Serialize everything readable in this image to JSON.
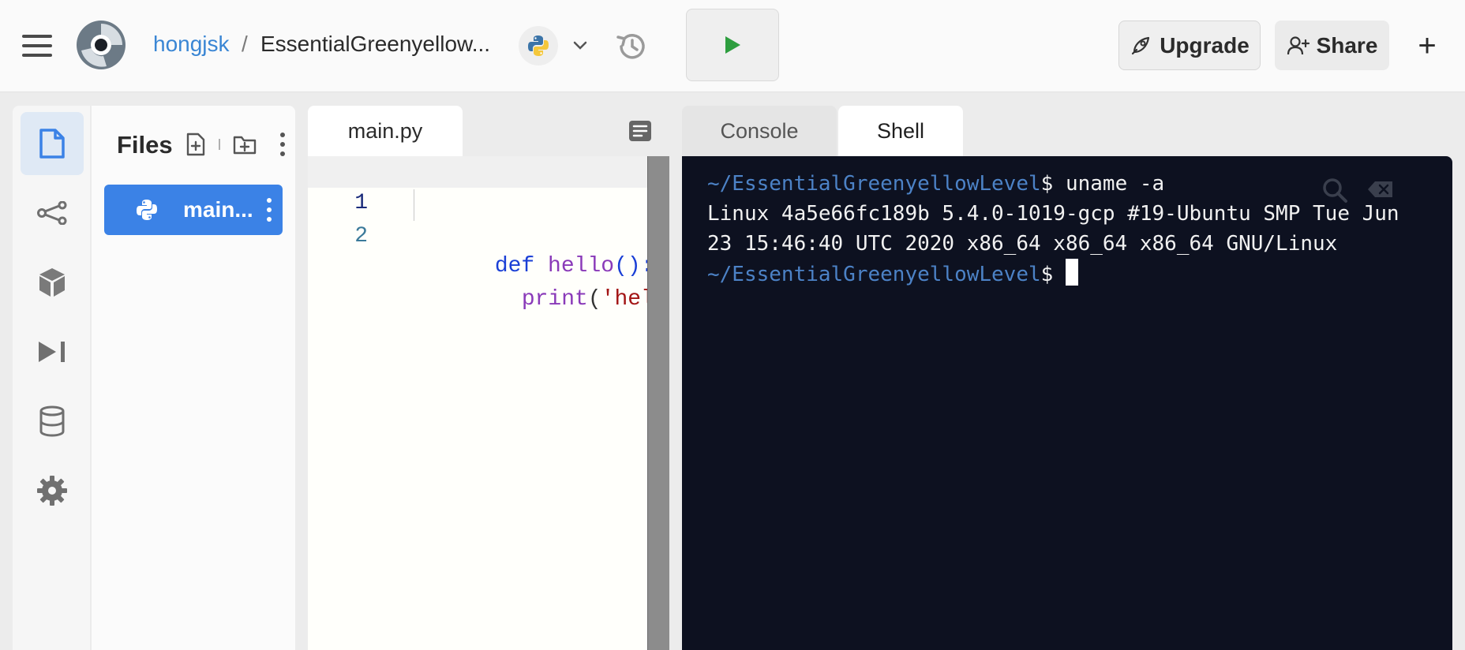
{
  "header": {
    "username": "hongjsk",
    "separator": "/",
    "repl_name": "EssentialGreenyellow...",
    "upgrade_label": "Upgrade",
    "share_label": "Share",
    "new_label": "+"
  },
  "sidebar": {
    "icons": [
      "files-icon",
      "version-control-icon",
      "packages-icon",
      "debugger-icon",
      "database-icon",
      "settings-icon"
    ],
    "active": "files-icon"
  },
  "files": {
    "title": "Files",
    "items": [
      {
        "name": "main...",
        "type": "python"
      }
    ]
  },
  "editor": {
    "tab_label": "main.py",
    "line_numbers": [
      "1",
      "2"
    ],
    "code": {
      "line1_kw": "def",
      "line1_fn": " hello",
      "line1_punct": "():",
      "line2_fn": "print",
      "line2_open": "(",
      "line2_str": "'hello'",
      "line2_close": ")"
    }
  },
  "terminal": {
    "tabs": [
      "Console",
      "Shell"
    ],
    "active_tab": "Shell",
    "prompt_path": "~/EssentialGreenyellowLevel",
    "prompt_symbol": "$ ",
    "command": "uname -a",
    "output_line1": "Linux 4a5e66fc189b 5.4.0-1019-gcp #19-Ubuntu SMP Tue Jun",
    "output_line2": "23 15:46:40 UTC 2020 x86_64 x86_64 x86_64 GNU/Linux"
  },
  "colors": {
    "accent": "#3b82e6",
    "link": "#3a86d4",
    "run_green": "#2e9e3f",
    "terminal_bg": "#0d1120",
    "prompt_blue": "#4c82c6"
  }
}
